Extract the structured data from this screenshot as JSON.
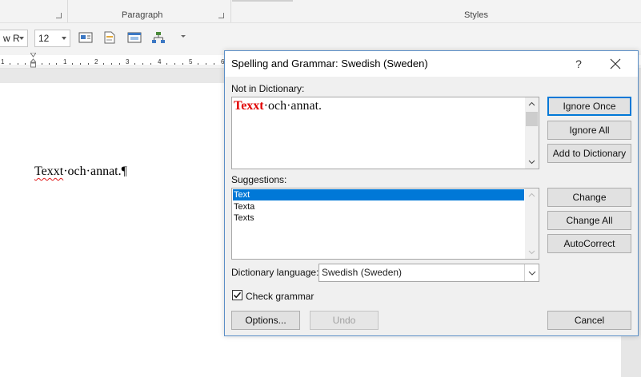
{
  "ribbon": {
    "group_paragraph": "Paragraph",
    "group_styles": "Styles",
    "font_name": "w R",
    "font_size": "12"
  },
  "ruler": {
    "numbers": [
      "1",
      "1",
      "2",
      "3",
      "4",
      "5",
      "6",
      "7"
    ]
  },
  "document": {
    "misspelled_word": "Texxt",
    "rest_text": "·och·annat.¶"
  },
  "dialog": {
    "title": "Spelling and Grammar: Swedish (Sweden)",
    "help_label": "?",
    "not_in_dictionary_label": "Not in Dictionary:",
    "not_in_dictionary": {
      "error_word": "Texxt",
      "rest_text": "·och·annat."
    },
    "suggestions_label": "Suggestions:",
    "suggestions": [
      "Text",
      "Texta",
      "Texts"
    ],
    "selected_suggestion_index": 0,
    "dictionary_language_label": "Dictionary language:",
    "dictionary_language_value": "Swedish (Sweden)",
    "check_grammar_label": "Check grammar",
    "check_grammar_checked": true,
    "buttons": {
      "ignore_once": "Ignore Once",
      "ignore_all": "Ignore All",
      "add_to_dictionary": "Add to Dictionary",
      "change": "Change",
      "change_all": "Change All",
      "autocorrect": "AutoCorrect",
      "options": "Options...",
      "undo": "Undo",
      "cancel": "Cancel"
    }
  },
  "colors": {
    "accent": "#0078d7",
    "error_text": "#e10000",
    "dialog_border": "#5b8fc7"
  }
}
